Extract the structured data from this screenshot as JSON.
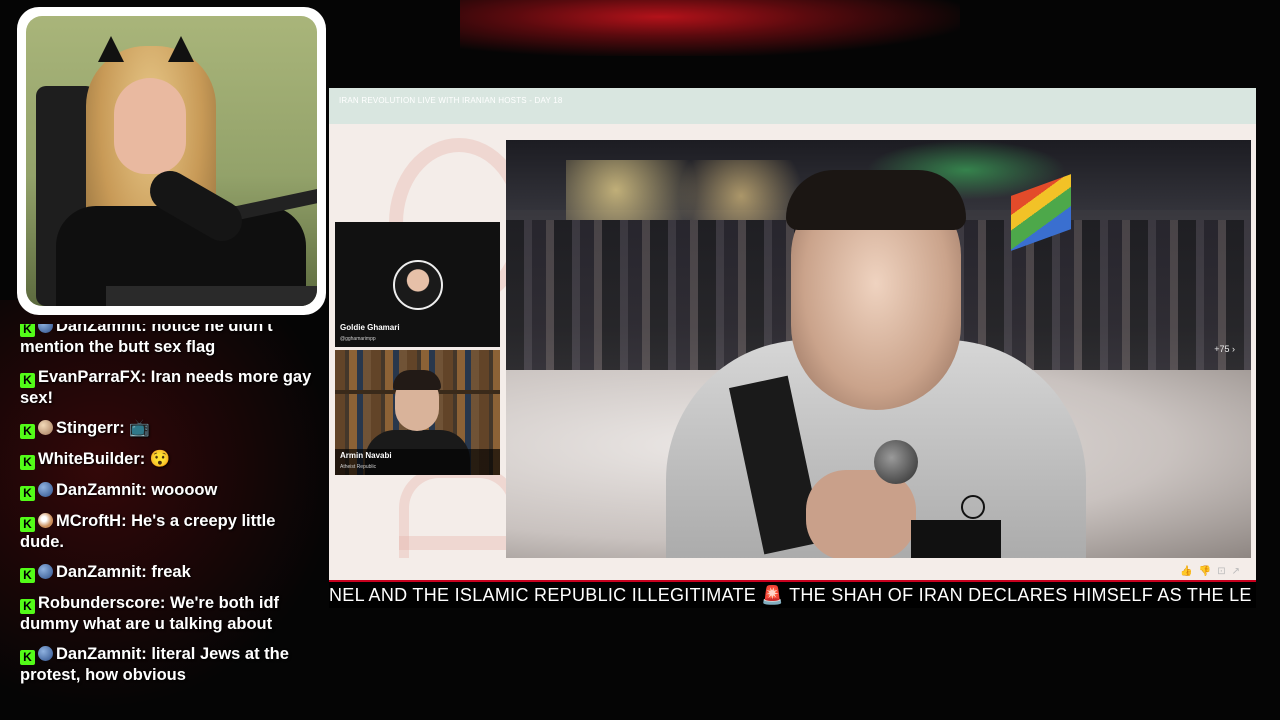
{
  "webcam": {},
  "chat": {
    "messages": [
      {
        "user": "DanZamnit",
        "text": "notice he didn't mention the butt sex flag",
        "display": "DanZamnit: notice he didn't mention the butt sex flag",
        "badge": "x",
        "cut": true
      },
      {
        "user": "EvanParraFX",
        "text": "Iran needs more gay sex!",
        "display": "EvanParraFX: Iran needs more gay sex!",
        "badge": "none"
      },
      {
        "user": "Stingerr",
        "text": "📺",
        "display": "Stingerr: 📺",
        "badge": "tan"
      },
      {
        "user": "WhiteBuilder",
        "text": "😯",
        "display": "WhiteBuilder: 😯",
        "badge": "none"
      },
      {
        "user": "DanZamnit",
        "text": "woooow",
        "display": "DanZamnit: woooow",
        "badge": "x"
      },
      {
        "user": "MCroftH",
        "text": "He's a creepy little dude.",
        "display": "MCroftH: He's a creepy little dude.",
        "badge": "pie"
      },
      {
        "user": "DanZamnit",
        "text": "freak",
        "display": "DanZamnit: freak",
        "badge": "x"
      },
      {
        "user": "Robunderscore",
        "text": "We're both idf dummy what are u talking about",
        "display": "Robunderscore: We're both idf dummy what are u talking about",
        "badge": "none"
      },
      {
        "user": "DanZamnit",
        "text": "literal Jews at the protest, how obvious",
        "display": "DanZamnit: literal Jews at the protest, how obvious",
        "badge": "x"
      }
    ],
    "badge_letter": "K"
  },
  "stream": {
    "title": "IRAN REVOLUTION LIVE WITH IRANIAN HOSTS - DAY 18",
    "guests": [
      {
        "name": "Goldie Ghamari",
        "handle": "@gghamarimpp"
      },
      {
        "name": "Armin Navabi",
        "handle": "Atheist Republic"
      }
    ],
    "more_count": "+75",
    "more_icon": "chevron-right-icon"
  },
  "ticker": {
    "text_before": "NEL AND THE ISLAMIC REPUBLIC ILLEGITIMATE ",
    "siren": "🚨",
    "text_after": " THE SHAH OF IRAN DECLARES HIMSELF AS THE LE"
  },
  "colors": {
    "kick_green": "#53fc18",
    "ticker_red": "#c8001e",
    "title_bar": "#d9e6e0"
  }
}
